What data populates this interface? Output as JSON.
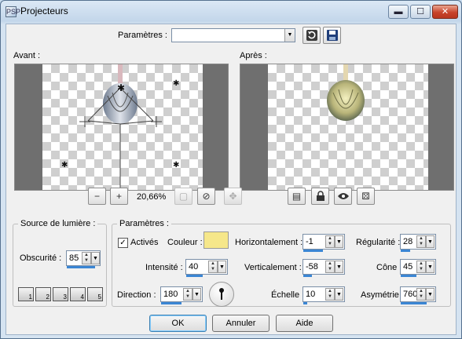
{
  "window": {
    "title": "Projecteurs",
    "app_icon": "PSP",
    "minimize_glyph": "▬",
    "maximize_glyph": "☐",
    "close_glyph": "✕"
  },
  "presets": {
    "label": "Paramètres :",
    "value": "",
    "dropdown_glyph": "▼",
    "reset_icon": "reset-icon",
    "save_icon": "save-icon"
  },
  "before": {
    "label": "Avant :",
    "zoom_value": "20,66%"
  },
  "after": {
    "label": "Après :"
  },
  "toolbar_glyphs": {
    "zoom_out": "−",
    "zoom_in": "+",
    "preview": "▢",
    "proof": "⊘",
    "navigate": "✥",
    "view_both": "▤",
    "randomize": "⚄"
  },
  "light_source": {
    "title": "Source de lumière :",
    "darkness_label": "Obscurité :",
    "darkness_value": "85",
    "darkness_percent": 85,
    "slots": [
      "1",
      "2",
      "3",
      "4",
      "5"
    ]
  },
  "params": {
    "title": "Paramètres :",
    "active_label": "Activés",
    "active_checked": true,
    "color_label": "Couleur :",
    "color_value": "#f6e78a",
    "intensity_label": "Intensité :",
    "intensity_value": "40",
    "direction_label": "Direction :",
    "direction_value": "180",
    "horizontal_label": "Horizontalement :",
    "horizontal_value": "-1",
    "vertical_label": "Verticalement :",
    "vertical_value": "-58",
    "scale_label": "Échelle :",
    "scale_value": "10",
    "regularity_label": "Régularité :",
    "regularity_value": "28",
    "cone_label": "Cône :",
    "cone_value": "45",
    "asymmetry_label": "Asymétrie :",
    "asymmetry_value": "760"
  },
  "buttons": {
    "ok": "OK",
    "cancel": "Annuler",
    "help": "Aide"
  }
}
